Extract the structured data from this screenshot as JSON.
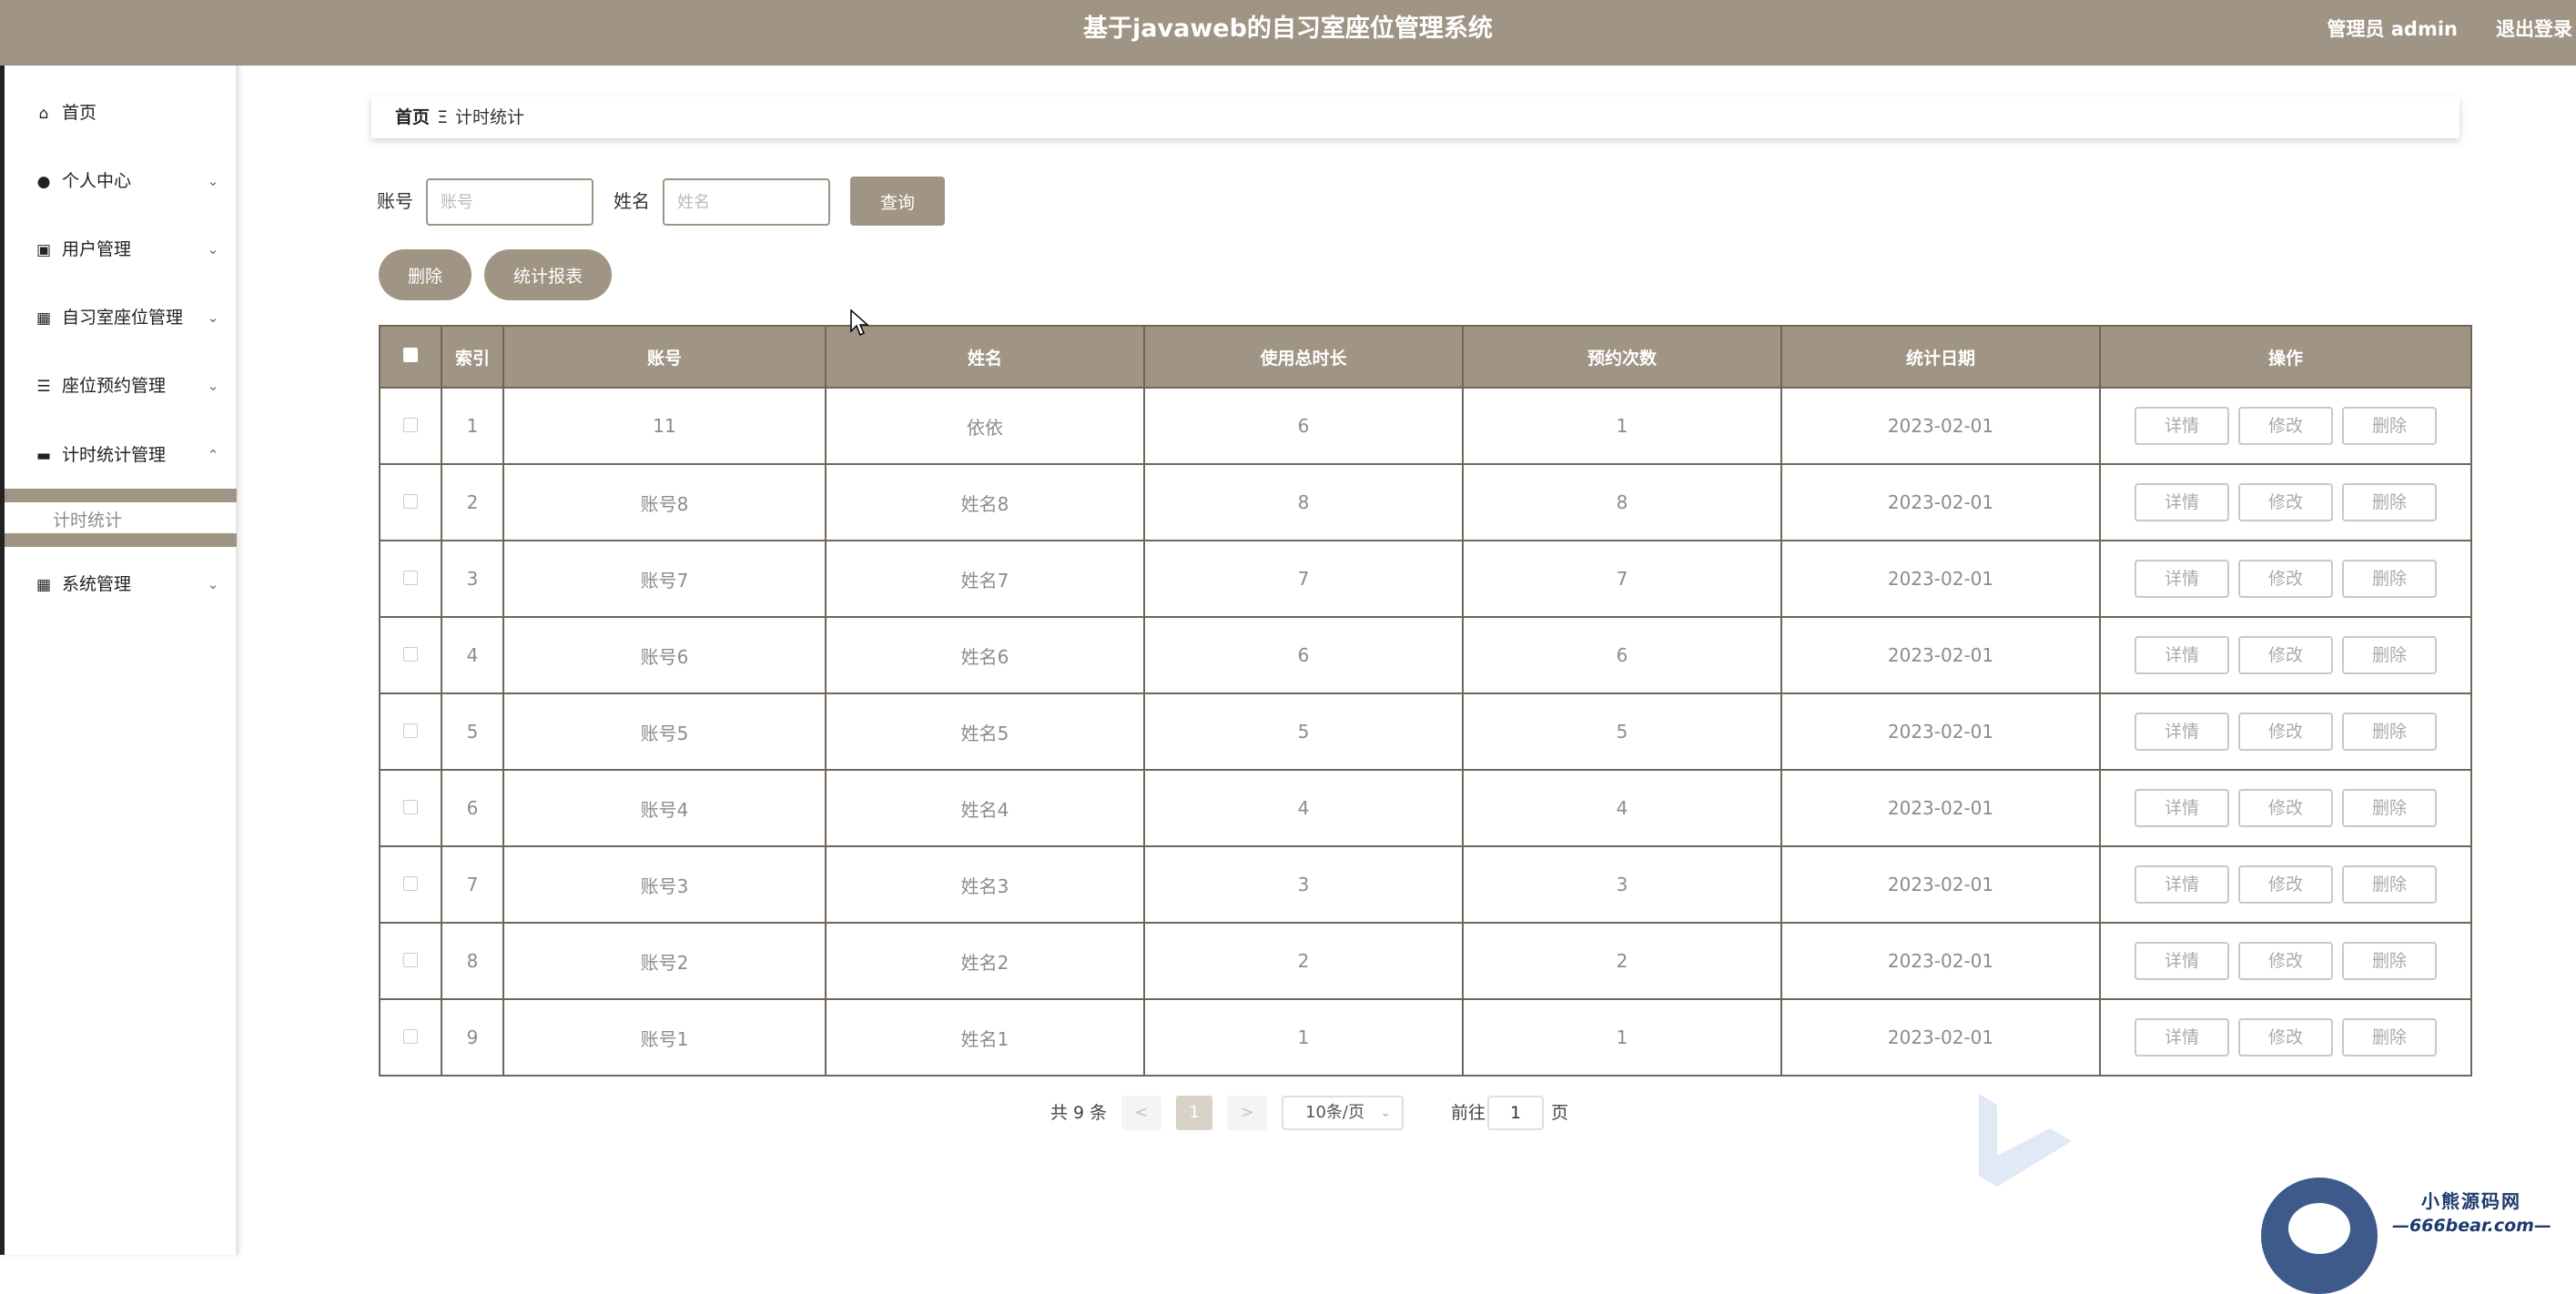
{
  "header": {
    "title": "基于javaweb的自习室座位管理系统",
    "user": "管理员 admin",
    "logout": "退出登录",
    "color": "#a09584"
  },
  "sidebar": {
    "items": [
      {
        "label": "首页",
        "icon": "home-icon"
      },
      {
        "label": "个人中心",
        "icon": "person-icon"
      },
      {
        "label": "用户管理",
        "icon": "clipboard-icon"
      },
      {
        "label": "自习室座位管理",
        "icon": "grid-icon"
      },
      {
        "label": "座位预约管理",
        "icon": "sliders-icon"
      },
      {
        "label": "计时统计管理",
        "icon": "monitor-icon"
      },
      {
        "label": "系统管理",
        "icon": "grid-icon"
      }
    ],
    "sub_item": "计时统计"
  },
  "breadcrumb": {
    "home": "首页",
    "separator": "Ξ",
    "current": "计时统计"
  },
  "search": {
    "account_label": "账号",
    "account_placeholder": "账号",
    "name_label": "姓名",
    "name_placeholder": "姓名",
    "query_button": "查询"
  },
  "actions": {
    "delete": "删除",
    "report": "统计报表"
  },
  "table": {
    "headers": [
      "索引",
      "账号",
      "姓名",
      "使用总时长",
      "预约次数",
      "统计日期",
      "操作"
    ],
    "rows": [
      {
        "index": "1",
        "account": "11",
        "name": "依依",
        "total": "6",
        "count": "1",
        "date": "2023-02-01"
      },
      {
        "index": "2",
        "account": "账号8",
        "name": "姓名8",
        "total": "8",
        "count": "8",
        "date": "2023-02-01"
      },
      {
        "index": "3",
        "account": "账号7",
        "name": "姓名7",
        "total": "7",
        "count": "7",
        "date": "2023-02-01"
      },
      {
        "index": "4",
        "account": "账号6",
        "name": "姓名6",
        "total": "6",
        "count": "6",
        "date": "2023-02-01"
      },
      {
        "index": "5",
        "account": "账号5",
        "name": "姓名5",
        "total": "5",
        "count": "5",
        "date": "2023-02-01"
      },
      {
        "index": "6",
        "account": "账号4",
        "name": "姓名4",
        "total": "4",
        "count": "4",
        "date": "2023-02-01"
      },
      {
        "index": "7",
        "account": "账号3",
        "name": "姓名3",
        "total": "3",
        "count": "3",
        "date": "2023-02-01"
      },
      {
        "index": "8",
        "account": "账号2",
        "name": "姓名2",
        "total": "2",
        "count": "2",
        "date": "2023-02-01"
      },
      {
        "index": "9",
        "account": "账号1",
        "name": "姓名1",
        "total": "1",
        "count": "1",
        "date": "2023-02-01"
      }
    ],
    "row_buttons": {
      "detail": "详情",
      "edit": "修改",
      "delete": "删除"
    }
  },
  "pagination": {
    "total": "共 9 条",
    "prev": "<",
    "current_page": "1",
    "next": ">",
    "page_size": "10条/页",
    "goto_label": "前往",
    "goto_value": "1",
    "page_suffix": "页"
  },
  "watermark": {
    "line1": "小熊源码网",
    "line2": "—666bear.com—"
  }
}
